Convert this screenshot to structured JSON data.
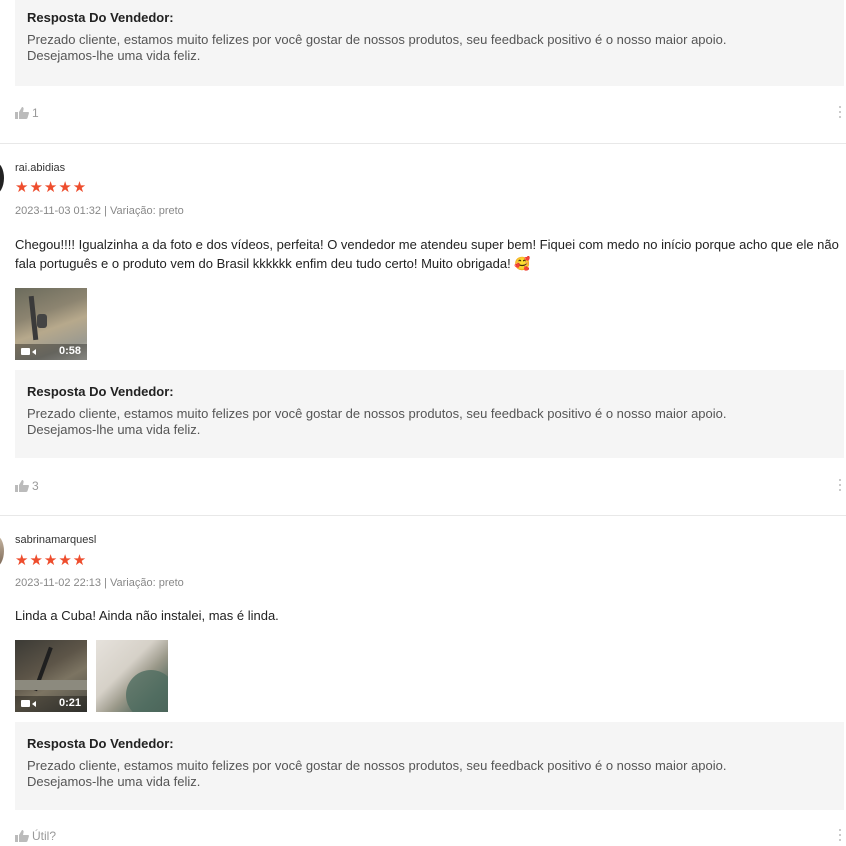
{
  "reply_section": {
    "title": "Resposta Do Vendedor:",
    "text_line1": "Prezado cliente, estamos muito felizes por você gostar de nossos produtos, seu feedback positivo é o nosso maior apoio.",
    "text_line2": "Desejamos-lhe uma vida feliz."
  },
  "reviews": [
    {
      "like_label": "1"
    },
    {
      "username": "rai.abidias",
      "stars": "★★★★★",
      "meta": "2023-11-03 01:32 | Variação: preto",
      "text": "Chegou!!!! Igualzinha a da foto e dos vídeos, perfeita! O vendedor me atendeu super bem! Fiquei com medo no início porque acho que ele não fala português e o produto vem do Brasil kkkkkk enfim deu tudo certo! Muito obrigada! 🥰",
      "video_duration": "0:58",
      "like_label": "3"
    },
    {
      "username": "sabrinamarquesl",
      "stars": "★★★★★",
      "meta": "2023-11-02 22:13 | Variação: preto",
      "text": "Linda a Cuba! Ainda não instalei, mas é linda.",
      "video_duration": "0:21",
      "like_label": "Útil?"
    }
  ],
  "colors": {
    "star": "#ee4d2d",
    "reply_bg": "#f5f5f5",
    "muted": "#999999"
  },
  "icons": {
    "like": "thumbs-up-icon",
    "more": "more-vertical-icon",
    "video": "video-camera-icon"
  }
}
